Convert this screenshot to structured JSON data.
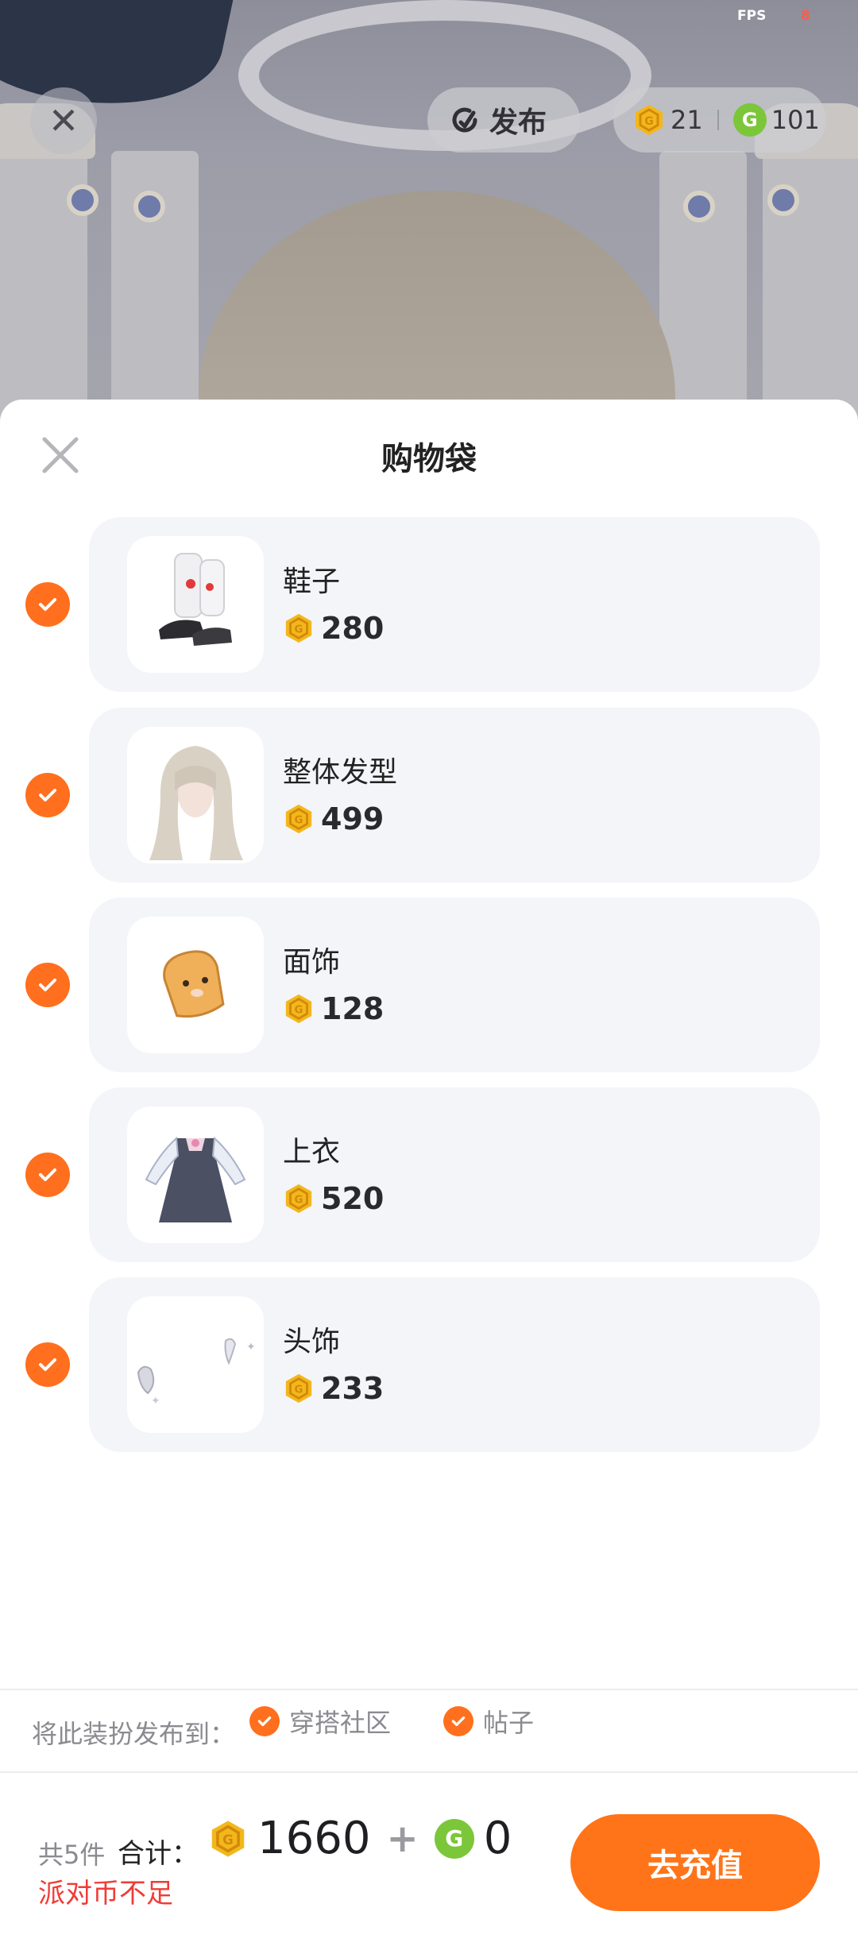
{
  "status": {
    "fps_label": "FPS",
    "fps_value": "8"
  },
  "top_bar": {
    "publish_label": "发布",
    "gold_balance": "21",
    "green_balance": "101"
  },
  "sheet": {
    "title": "购物袋",
    "items": [
      {
        "name": "鞋子",
        "price": "280"
      },
      {
        "name": "整体发型",
        "price": "499"
      },
      {
        "name": "面饰",
        "price": "128"
      },
      {
        "name": "上衣",
        "price": "520"
      },
      {
        "name": "头饰",
        "price": "233"
      }
    ],
    "publish_to_label": "将此装扮发布到：",
    "publish_options": [
      "穿搭社区",
      "帖子"
    ]
  },
  "footer": {
    "count_label": "共5件",
    "total_label": "合计：",
    "gold_total": "1660",
    "plus": "+",
    "green_total": "0",
    "warning": "派对币不足",
    "recharge_label": "去充值"
  },
  "colors": {
    "accent": "#ff7418",
    "warning": "#f03c36",
    "gold": "#f3b71c",
    "green": "#7cc63a"
  }
}
